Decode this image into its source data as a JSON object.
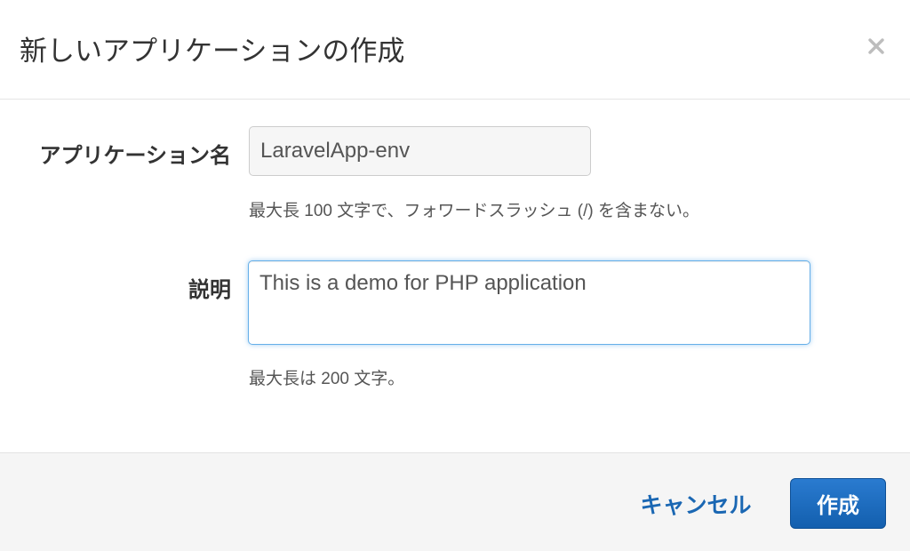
{
  "dialog": {
    "title": "新しいアプリケーションの作成",
    "close_icon": "close-icon"
  },
  "form": {
    "app_name": {
      "label": "アプリケーション名",
      "value": "LaravelApp-env",
      "help": "最大長 100 文字で、フォワードスラッシュ (/) を含まない。"
    },
    "description": {
      "label": "説明",
      "value": "This is a demo for PHP application",
      "help": "最大長は 200 文字。"
    }
  },
  "footer": {
    "cancel_label": "キャンセル",
    "create_label": "作成"
  },
  "colors": {
    "primary": "#1a67b3",
    "focus_border": "#66afe9",
    "footer_bg": "#f5f5f5"
  }
}
